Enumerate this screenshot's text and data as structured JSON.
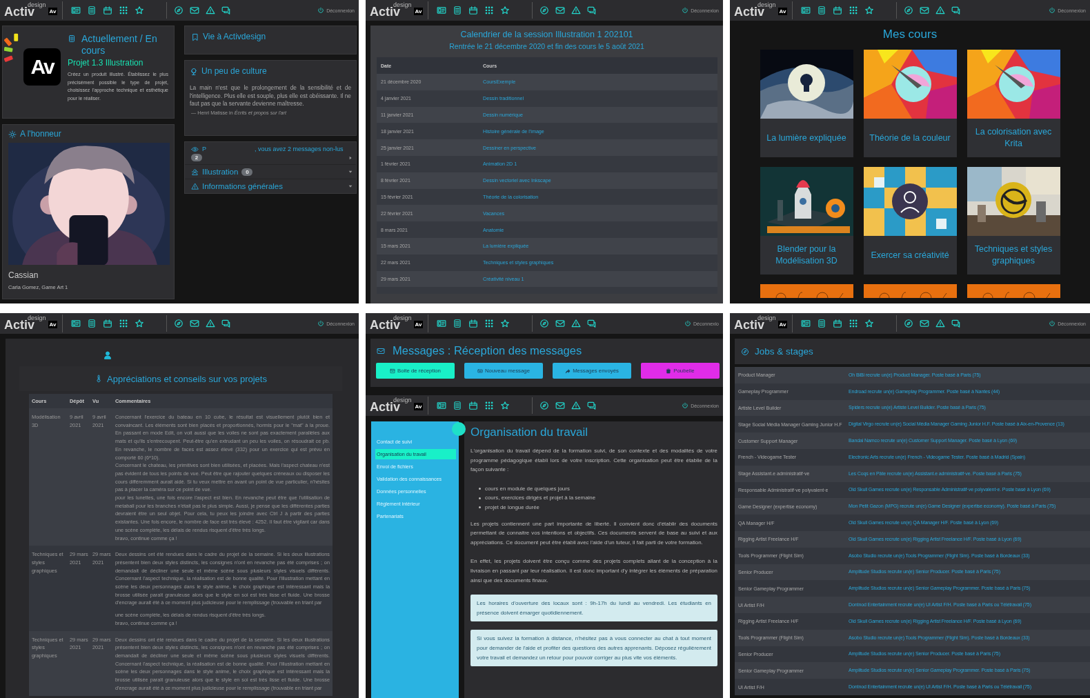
{
  "home": {
    "navbar": {
      "brand": "Activ",
      "brand_sup": "design",
      "badge": "Av",
      "logout": "Déconnexion"
    },
    "current": {
      "logo": "Av",
      "title": "Actuellement / En cours",
      "project": "Projet 1.3 Illustration",
      "description": "Créez un produit illustré. Établissez le plus précisément possible le type de projet, choisissez l'approche technique et esthétique pour le réaliser."
    },
    "featured": {
      "title": "A l'honneur",
      "name": "Cassian",
      "credit": "Carla Gomez, Game Art 1"
    },
    "life": {
      "title": "Vie à Activdesign"
    },
    "culture": {
      "title": "Un peu de culture",
      "quote": "La main n'est que le prolongement de la sensibilité et de l'intelligence. Plus elle est souple, plus elle est obéissante. Il ne faut pas que la servante devienne maîtresse.",
      "source": "— Henri Matisse in *Écrits et propos sur l'art*"
    },
    "messages": {
      "greeting_start": "P",
      "greeting_end": ", vous avez 2 messages non-lus",
      "count": "2"
    },
    "groups": [
      {
        "kind": "group",
        "label": "Illustration",
        "count": "0"
      },
      {
        "kind": "info",
        "label": "Informations générales"
      }
    ]
  },
  "calendar": {
    "navbar": {
      "brand": "Activ",
      "brand_sup": "design",
      "badge": "Av",
      "logout": "Déconnexion"
    },
    "title": "Calendrier de la session Illustration 1 202101",
    "subtitle": "Rentrée le 21 décembre 2020 et fin des cours le 5 août 2021",
    "columns": [
      "Date",
      "Cours"
    ],
    "rows": [
      {
        "date": "21 décembre 2020",
        "course": "CoursExemple"
      },
      {
        "date": "4 janvier 2021",
        "course": "Dessin traditionnel"
      },
      {
        "date": "11 janvier 2021",
        "course": "Dessin numérique"
      },
      {
        "date": "18 janvier 2021",
        "course": "Histoire générale de l'image"
      },
      {
        "date": "25 janvier 2021",
        "course": "Dessiner en perspective"
      },
      {
        "date": "1 février 2021",
        "course": "Animation 2D 1"
      },
      {
        "date": "8 février 2021",
        "course": "Dessin vectoriel avec Inkscape"
      },
      {
        "date": "15 février 2021",
        "course": "Théorie de la colorisation"
      },
      {
        "date": "22 février 2021",
        "course": "Vacances"
      },
      {
        "date": "8 mars 2021",
        "course": "Anatomie"
      },
      {
        "date": "15 mars 2021",
        "course": "La lumière expliquée"
      },
      {
        "date": "22 mars 2021",
        "course": "Techniques et styles graphiques"
      },
      {
        "date": "29 mars 2021",
        "course": "Créativité niveau 1"
      }
    ]
  },
  "courses": {
    "navbar": {
      "brand": "Activ",
      "brand_sup": "design",
      "badge": "Av",
      "logout": "Déconnexion"
    },
    "title": "Mes cours",
    "cards": [
      {
        "title": "La lumière expliquée"
      },
      {
        "title": "Théorie de la couleur"
      },
      {
        "title": "La colorisation avec Krita"
      },
      {
        "title": "Blender pour la Modélisation 3D"
      },
      {
        "title": "Exercer sa créativité"
      },
      {
        "title": "Techniques et styles graphiques"
      }
    ]
  },
  "reviews": {
    "navbar": {
      "brand": "Activ",
      "brand_sup": "design",
      "badge": "Av",
      "logout": "Déconnexion"
    },
    "title": "Appréciations et conseils sur vos projets",
    "columns": [
      "Cours",
      "Dépôt",
      "Vu",
      "Commentaires"
    ],
    "rows": [
      {
        "course": "Modélisation 3D",
        "submitted": "9 avril 2021",
        "seen": "9 avril 2021",
        "comment": "Concernant l'exercice du bateau en 10 cube, le résultat est visuellement plutôt bien et convaincant. Les éléments sont bien placés et proportionnés, hormis pour le \"mat\" à la proue. En passant en mode Edit, on voit aussi que les voiles ne sont pas exactement parallèles aux mats et qu'ils s'entrecoupent. Peut-être qu'en extrudant un peu les voiles, on résoudrait ce pb. En revanche, le nombre de faces est assez élevé (332) pour un exercice qui est prévu en comporté 60 (6*10).\nConcernant le chateau, les primitives sont bien utilisées, et placées. Mais l'aspect chateau n'est pas évident de tous les points de vue. Peut être que rajouter quelques créneaux ou disposer les cours différemment aurait aidé. Si tu veux mettre en avant un point de vue particulier, n'hésites pas à placer la caméra sur ce point de vue.\npour les lunettes, une fois encore l'aspect est bien. En revanche peut être que l'utilisation de metaball pour les branches n'était pas le plus simple. Aussi, je pense que les différentes parties devraient être un seul objet. Pour cela, tu peux les joindre avec Ctrl J à partir des parties existantes. Une fois encore, le nombre de face est très élevé : 4252. Il faut être vigilant car dans une scène complète, les délais de rendus risquent d'être très longs.\nbravo, continue comme ça !"
      },
      {
        "course": "Techniques et styles graphiques",
        "submitted": "29 mars 2021",
        "seen": "29 mars 2021",
        "comment": "Deux dessins ont été rendues dans le cadre du projet de la semaine. Si les deux illustrations présentent bien deux styles distincts, les consignes n'ont en revanche pas été comprises ; on demandait de décliner une seule et même scène sous plusieurs styles visuels différents. Concernant l'aspect technique, la réalisation est de bonne qualité. Pour l'illustration mettant en scène les deux personnages dans le style anime, le choix graphique est intéressant mais la brosse utilisée paraît granuleuse alors que le style en soi est très lisse et fluide. Une brosse d'encrage aurait été à ce moment plus judicieuse pour le remplissage (trouvable en triant par",
        "overflow": "une scène complète, les délais de rendus risquent d'être très longs.\nbravo, continue comme ça !"
      },
      {
        "course": "Techniques et styles graphiques",
        "submitted": "29 mars 2021",
        "seen": "29 mars 2021",
        "comment": "Deux dessins ont été rendues dans le cadre du projet de la semaine. Si les deux illustrations présentent bien deux styles distincts, les consignes n'ont en revanche pas été comprises ; on demandait de décliner une seule et même scène sous plusieurs styles visuels différents. Concernant l'aspect technique, la réalisation est de bonne qualité. Pour l'illustration mettant en scène les deux personnages dans le style anime, le choix graphique est intéressant mais la brosse utilisée paraît granuleuse alors que le style en soi est très lisse et fluide. Une brosse d'encrage aurait été à ce moment plus judicieuse pour le remplissage (trouvable en triant par"
      }
    ]
  },
  "messages": {
    "navbar": {
      "brand": "Activ",
      "brand_sup": "design",
      "badge": "Av",
      "logout": "Déconnexio"
    },
    "title": "Messages : Réception des messages",
    "buttons": [
      {
        "kind": "inbox",
        "label": "Boite de réception",
        "color": "#19f0c8"
      },
      {
        "kind": "new",
        "label": "Nouveau message",
        "color": "#2ab4e3"
      },
      {
        "kind": "sent",
        "label": "Messages envoyés",
        "color": "#2ab4e3"
      },
      {
        "kind": "trash",
        "label": "Poubelle",
        "color": "#e02ce8"
      }
    ]
  },
  "rules": {
    "navbar": {
      "brand": "Activ",
      "brand_sup": "design",
      "badge": "Av",
      "logout": "Déconnexion"
    },
    "sidebar": [
      {
        "label": "Contact de suivi",
        "selected": false
      },
      {
        "label": "Organisation du travail",
        "selected": true
      },
      {
        "label": "Envoi de fichiers",
        "selected": false
      },
      {
        "label": "Validation des connaissances",
        "selected": false
      },
      {
        "label": "Données personnelles",
        "selected": false
      },
      {
        "label": "Règlement intérieur",
        "selected": false
      },
      {
        "label": "Partenariats",
        "selected": false
      }
    ],
    "title": "Organisation du travail",
    "intro": "L'organisation du travail dépend de la formation suivi, de son contexte et des modalités de votre programme pédagogique établi lors de votre inscription. Cette organisation peut être établie de la façon suivante :",
    "bullets": [
      "cours en module de quelques jours",
      "cours, exercices dirigés et projet à la semaine",
      "projet de longue durée"
    ],
    "paragraphs": [
      "Les projets contiennent une part importante de liberté. Il convient donc d'établir des documents permettant de connaitre vos intentions et objectifs. Ces documents servent de base au suivi et aux appréciations. Ce document peut être établi avec l'aide d'un tuteur, il fait parti de votre formation.",
      "En effet, les projets doivent être conçu comme des projets complets allant de la conception à la livraison en passant par leur réalisation. Il est donc important d'y intégrer les éléments de préparation ainsi que des documents finaux."
    ],
    "notes": [
      "Les horaires d'ouverture des locaux sont : 9h-17h du lundi au vendredi. Les étudiants en présence doivent émarger quotidiennement.",
      "Si vous suivez la formation à distance, n'hésitez pas à vous connecter au chat à tout moment pour demander de l'aide et profiter des questions des autres apprenants. Déposez régulièrement votre travail et demandez un retour pour pouvoir corriger au plus vite vos éléments."
    ]
  },
  "jobs": {
    "navbar": {
      "brand": "Activ",
      "brand_sup": "design",
      "badge": "Av",
      "logout": "Déconnexion"
    },
    "title": "Jobs & stages",
    "rows": [
      {
        "position": "Product Manager",
        "offer": "Oh BiBi recrute un(e) Product Manager. Poste basé à Paris (75)"
      },
      {
        "position": "Gameplay Programmer",
        "offer": "Endroad recrute un(e) Gameplay Programmer. Poste basé à Nantes (44)"
      },
      {
        "position": "Artiste Level Builder",
        "offer": "Spiders recrute un(e) Artiste Level Builder. Poste basé à Paris (75)"
      },
      {
        "position": "Stage Social Média Manager Gaming Junior H.F",
        "offer": "Digital Virgo recrute un(e) Social Média Manager Gaming Junior H.F. Poste basé à Aix-en-Provence (13)"
      },
      {
        "position": "Customer Support Manager",
        "offer": "Bandai Namco recrute un(e) Customer Support Manager. Poste basé à Lyon (69)"
      },
      {
        "position": "French - Videogame Tester",
        "offer": "Electronic Arts recrute un(e) French - Videogame Tester. Poste basé à Madrid (Spain)"
      },
      {
        "position": "Stage Assistant.e administratif·ve",
        "offer": "Les Coqs en Pâte recrute un(e) Assistant.e administratif·ve. Poste basé à Paris (75)"
      },
      {
        "position": "Responsable Administratif·ve polyvalent·e",
        "offer": "Old Skull Games recrute un(e) Responsable Administratif·ve polyvalent·e. Poste basé à Lyon (69)"
      },
      {
        "position": "Game Designer (expertise economy)",
        "offer": "Mon Petit Gazon (MPG) recrute un(e) Game Designer (expertise economy). Poste basé à Paris (75)"
      },
      {
        "position": "QA Manager H/F",
        "offer": "Old Skull Games recrute un(e) QA Manager H/F. Poste basé à Lyon (69)"
      },
      {
        "position": "Rigging Artist Freelance H/F",
        "offer": "Old Skull Games recrute un(e) Rigging Artist Freelance H/F. Poste basé à Lyon (69)"
      },
      {
        "position": "Tools Programmer (Flight Sim)",
        "offer": "Asobo Studio recrute un(e) Tools Programmer (Flight Sim). Poste basé à Bordeaux (33)"
      },
      {
        "position": "Senior Producer",
        "offer": "Amplitude Studios recrute un(e) Senior Producer. Poste basé à Paris (75)"
      },
      {
        "position": "Senior Gameplay Programmer",
        "offer": "Amplitude Studios recrute un(e) Senior Gameplay Programmer. Poste basé à Paris (75)"
      },
      {
        "position": "UI Artist F/H",
        "offer": "Dontnod Entertainment recrute un(e) UI Artist F/H. Poste basé à Paris ou Télétravail (75)"
      },
      {
        "position": "Rigging Artist Freelance H/F",
        "offer": "Old Skull Games recrute un(e) Rigging Artist Freelance H/F. Poste basé à Lyon (69)"
      },
      {
        "position": "Tools Programmer (Flight Sim)",
        "offer": "Asobo Studio recrute un(e) Tools Programmer (Flight Sim). Poste basé à Bordeaux (33)"
      },
      {
        "position": "Senior Producer",
        "offer": "Amplitude Studios recrute un(e) Senior Producer. Poste basé à Paris (75)"
      },
      {
        "position": "Senior Gameplay Programmer",
        "offer": "Amplitude Studios recrute un(e) Senior Gameplay Programmer. Poste basé à Paris (75)"
      },
      {
        "position": "UI Artist F/H",
        "offer": "Dontnod Entertainment recrute un(e) UI Artist F/H. Poste basé à Paris ou Télétravail (75)"
      }
    ]
  }
}
